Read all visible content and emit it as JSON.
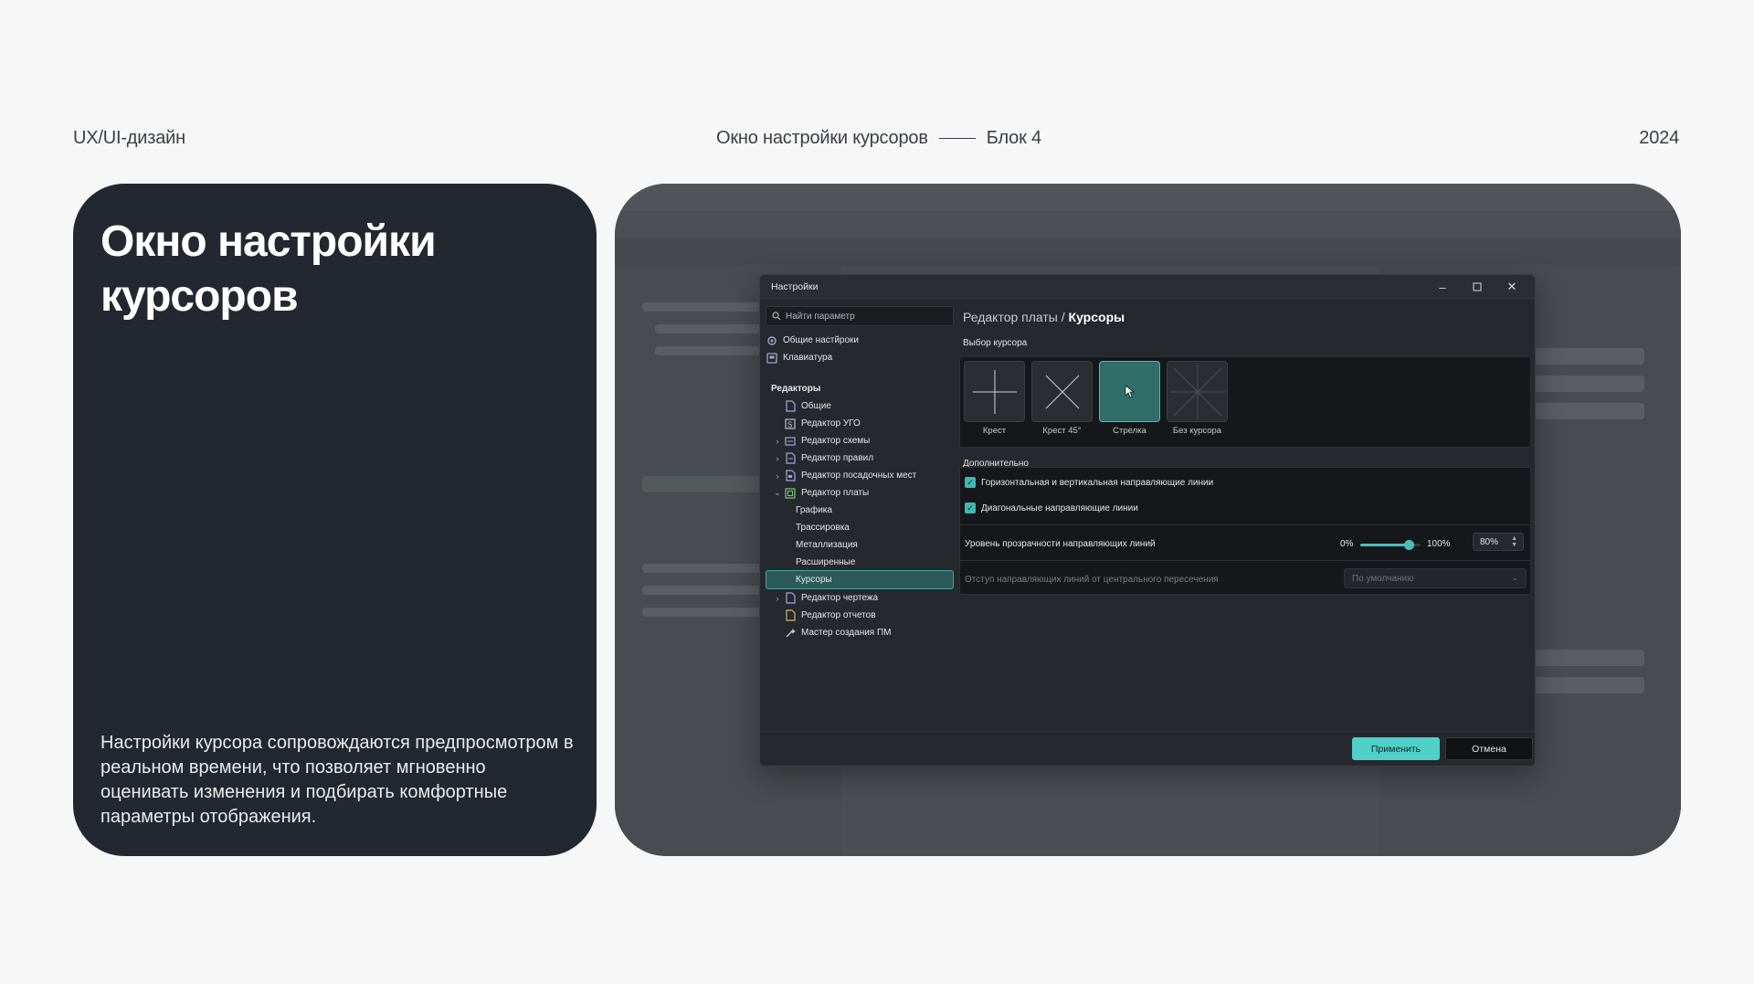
{
  "header": {
    "left": "UX/UI-дизайн",
    "center_title": "Окно настройки курсоров",
    "center_block": "Блок 4",
    "year": "2024"
  },
  "card": {
    "title": "Окно настройки курсоров",
    "description": "Настройки курсора сопровождаются предпросмотром в реальном времени, что позволяет мгновенно оценивать изменения и подбирать комфортные параметры отображения."
  },
  "dialog": {
    "title": "Настройки",
    "search_placeholder": "Найти параметр",
    "sidebar": {
      "top_items": [
        {
          "label": "Общие настйроки",
          "icon": "gear-icon"
        },
        {
          "label": "Клавиатура",
          "icon": "keyboard-icon"
        }
      ],
      "section_label": "Редакторы",
      "editors": [
        {
          "label": "Общие",
          "icon": "document-icon",
          "expandable": false
        },
        {
          "label": "Редактор УГО",
          "icon": "symbol-icon",
          "expandable": false
        },
        {
          "label": "Редактор схемы",
          "icon": "schematic-icon",
          "expandable": true
        },
        {
          "label": "Редактор правил",
          "icon": "rules-icon",
          "expandable": true
        },
        {
          "label": "Редактор посадочных мест",
          "icon": "footprint-icon",
          "expandable": true
        },
        {
          "label": "Редактор платы",
          "icon": "board-icon",
          "expandable": true,
          "expanded": true
        }
      ],
      "board_children": [
        "Графика",
        "Трассировка",
        "Металлизация",
        "Расширенные",
        "Курсоры"
      ],
      "active_child": "Курсоры",
      "bottom_items": [
        {
          "label": "Редактор чертежа",
          "icon": "drawing-icon",
          "expandable": true
        },
        {
          "label": "Редактор отчетов",
          "icon": "report-icon",
          "expandable": false
        },
        {
          "label": "Мастер создания ПМ",
          "icon": "wizard-icon",
          "expandable": false
        }
      ]
    },
    "breadcrumb_parent": "Редактор платы",
    "breadcrumb_separator": " / ",
    "breadcrumb_current": "Курсоры",
    "cursor_section_label": "Выбор курсора",
    "cursor_options": [
      "Крест",
      "Крест 45°",
      "Стрелка",
      "Без курсора"
    ],
    "selected_cursor": "Стрелка",
    "extra_section_label": "Дополнительно",
    "checkbox_1": {
      "label": "Горизонтальная и вертикальная направляющие линии",
      "checked": true
    },
    "checkbox_2": {
      "label": "Диагональные направляющие линии",
      "checked": true
    },
    "opacity_label": "Уровень прозрачности направляющих линий",
    "opacity_min": "0%",
    "opacity_max": "100%",
    "opacity_value": "80%",
    "opacity_fraction": 0.8,
    "offset_label": "Отступ направляющих линий от центрального пересечения",
    "offset_value": "По умолчанию",
    "apply_label": "Применить",
    "cancel_label": "Отмена"
  },
  "colors": {
    "accent": "#4fd0c8",
    "selected_tile": "#2f6e69",
    "card_bg": "#232830"
  }
}
